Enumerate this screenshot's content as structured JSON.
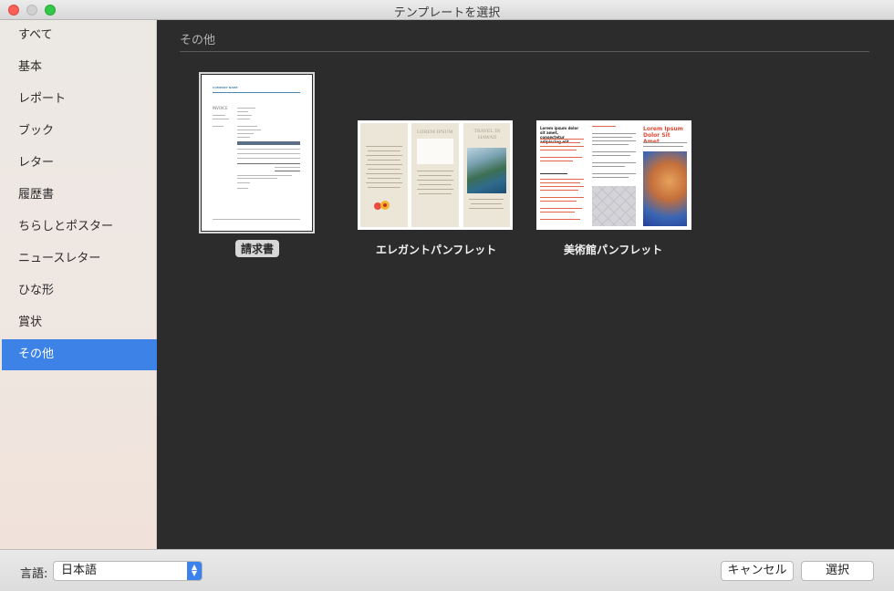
{
  "window": {
    "title": "テンプレートを選択"
  },
  "sidebar": {
    "items": [
      {
        "label": "すべて",
        "id": "all"
      },
      {
        "label": "基本",
        "id": "basic"
      },
      {
        "label": "レポート",
        "id": "report"
      },
      {
        "label": "ブック",
        "id": "book"
      },
      {
        "label": "レター",
        "id": "letter"
      },
      {
        "label": "履歴書",
        "id": "resume"
      },
      {
        "label": "ちらしとポスター",
        "id": "flyers"
      },
      {
        "label": "ニュースレター",
        "id": "newsletter"
      },
      {
        "label": "ひな形",
        "id": "stationery"
      },
      {
        "label": "賞状",
        "id": "certificate"
      },
      {
        "label": "その他",
        "id": "other"
      }
    ],
    "selected": "その他"
  },
  "main": {
    "section_title": "その他",
    "templates": [
      {
        "label": "請求書",
        "selected": true
      },
      {
        "label": "エレガントパンフレット",
        "selected": false
      },
      {
        "label": "美術館パンフレット",
        "selected": false
      }
    ],
    "invoice_thumb": {
      "brand": "COMPANY NAME",
      "heading": "INVOICE"
    },
    "elegant_thumb": {
      "panel_title_1": "LOREM IPSUM",
      "panel_title_2": "TRAVEL IN HAWAII"
    },
    "museum_thumb": {
      "heading_1": "Lorem ipsum dolor sit amet, consectetur adipiscing elit.",
      "heading_2": "Lorem Ipsum Dolor Sit Amet",
      "accent_color": "#e2654c"
    }
  },
  "bottom": {
    "language_label": "言語:",
    "language_value": "日本語",
    "cancel_label": "キャンセル",
    "select_label": "選択"
  },
  "colors": {
    "selection": "#3d82e6",
    "background": "#2c2c2c"
  }
}
